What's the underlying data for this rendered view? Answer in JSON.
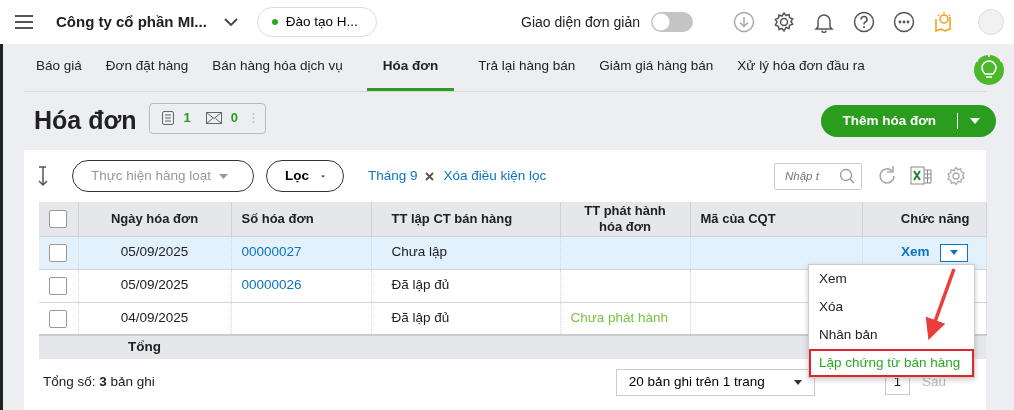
{
  "topbar": {
    "company": "Công ty cổ phần MI...",
    "branch": "Đào tạo H...",
    "branch_online": true,
    "simple_mode_label": "Giao diện đơn giản",
    "simple_mode_on": false
  },
  "tabs": [
    {
      "label": "Báo giá",
      "selected": false
    },
    {
      "label": "Đơn đặt hàng",
      "selected": false
    },
    {
      "label": "Bán hàng hóa dịch vụ",
      "selected": false
    },
    {
      "label": "Hóa đơn",
      "selected": true
    },
    {
      "label": "Trả lại hàng bán",
      "selected": false
    },
    {
      "label": "Giảm giá hàng bán",
      "selected": false
    },
    {
      "label": "Xử lý hóa đơn đầu ra",
      "selected": false
    }
  ],
  "page": {
    "title": "Hóa đơn",
    "counts": [
      "1",
      "0"
    ],
    "add_button": "Thêm hóa đơn"
  },
  "toolbar": {
    "bulk_action": "Thực hiện hàng loạt",
    "filter": "Lọc",
    "filter_tag": "Tháng 9",
    "clear_filter": "Xóa điều kiện lọc",
    "search_placeholder": "Nhập t"
  },
  "table": {
    "columns": [
      "Ngày hóa đơn",
      "Số hóa đơn",
      "TT lập CT bán hàng",
      "TT phát hành hóa đơn",
      "Mã của CQT",
      "Chức năng"
    ],
    "rows": [
      {
        "selected": true,
        "checked": false,
        "date": "05/09/2025",
        "number": "00000027",
        "sales_status": "Chưa lập",
        "issue_status": "",
        "action": "Xem"
      },
      {
        "selected": false,
        "checked": false,
        "date": "05/09/2025",
        "number": "00000026",
        "sales_status": "Đã lập đủ",
        "issue_status": "",
        "action": ""
      },
      {
        "selected": false,
        "checked": false,
        "date": "04/09/2025",
        "number": "",
        "sales_status": "Đã lập đủ",
        "issue_status": "Chưa phát hành",
        "action": ""
      }
    ],
    "total_label": "Tổng",
    "all_checked": false
  },
  "footer": {
    "total": "Tổng số: **3** bản ghi",
    "page_size": "20 bản ghi trên 1 trang",
    "page": "1",
    "next": "Sau"
  },
  "menu": [
    {
      "label": "Xem",
      "highlighted": false
    },
    {
      "label": "Xóa",
      "highlighted": false
    },
    {
      "label": "Nhân bản",
      "highlighted": false
    },
    {
      "label": "Lập chứng từ bán hàng",
      "highlighted": true
    }
  ]
}
